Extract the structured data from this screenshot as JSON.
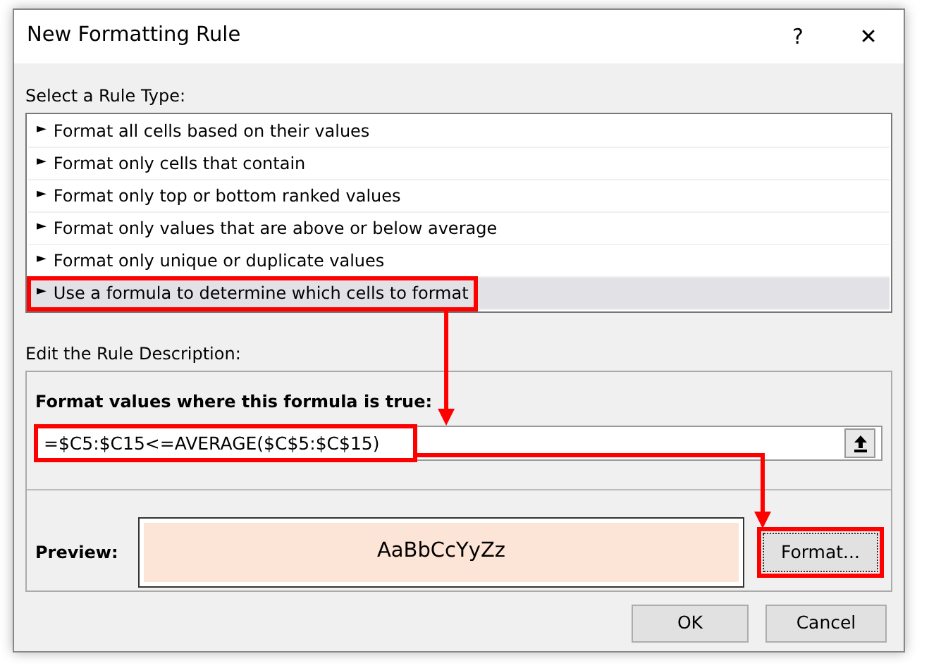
{
  "window": {
    "title": "New Formatting Rule",
    "help": "?",
    "close": "✕"
  },
  "rule_type": {
    "label": "Select a Rule Type:",
    "items": [
      {
        "marker": "►",
        "label": "Format all cells based on their values",
        "selected": false,
        "annotated": false
      },
      {
        "marker": "►",
        "label": "Format only cells that contain",
        "selected": false,
        "annotated": false
      },
      {
        "marker": "►",
        "label": "Format only top or bottom ranked values",
        "selected": false,
        "annotated": false
      },
      {
        "marker": "►",
        "label": "Format only values that are above or below average",
        "selected": false,
        "annotated": false
      },
      {
        "marker": "►",
        "label": "Format only unique or duplicate values",
        "selected": false,
        "annotated": false
      },
      {
        "marker": "►",
        "label": "Use a formula to determine which cells to format",
        "selected": true,
        "annotated": true
      }
    ]
  },
  "description": {
    "label": "Edit the Rule Description:",
    "formula_label": "Format values where this formula is true:",
    "formula": "=$C5:$C15<=AVERAGE($C$5:$C$15)",
    "formula_annotated": true,
    "preview_label": "Preview:",
    "preview_text": "AaBbCcYyZz",
    "format_button": "Format...",
    "format_annotated": true
  },
  "buttons": [
    "OK",
    "Cancel"
  ]
}
